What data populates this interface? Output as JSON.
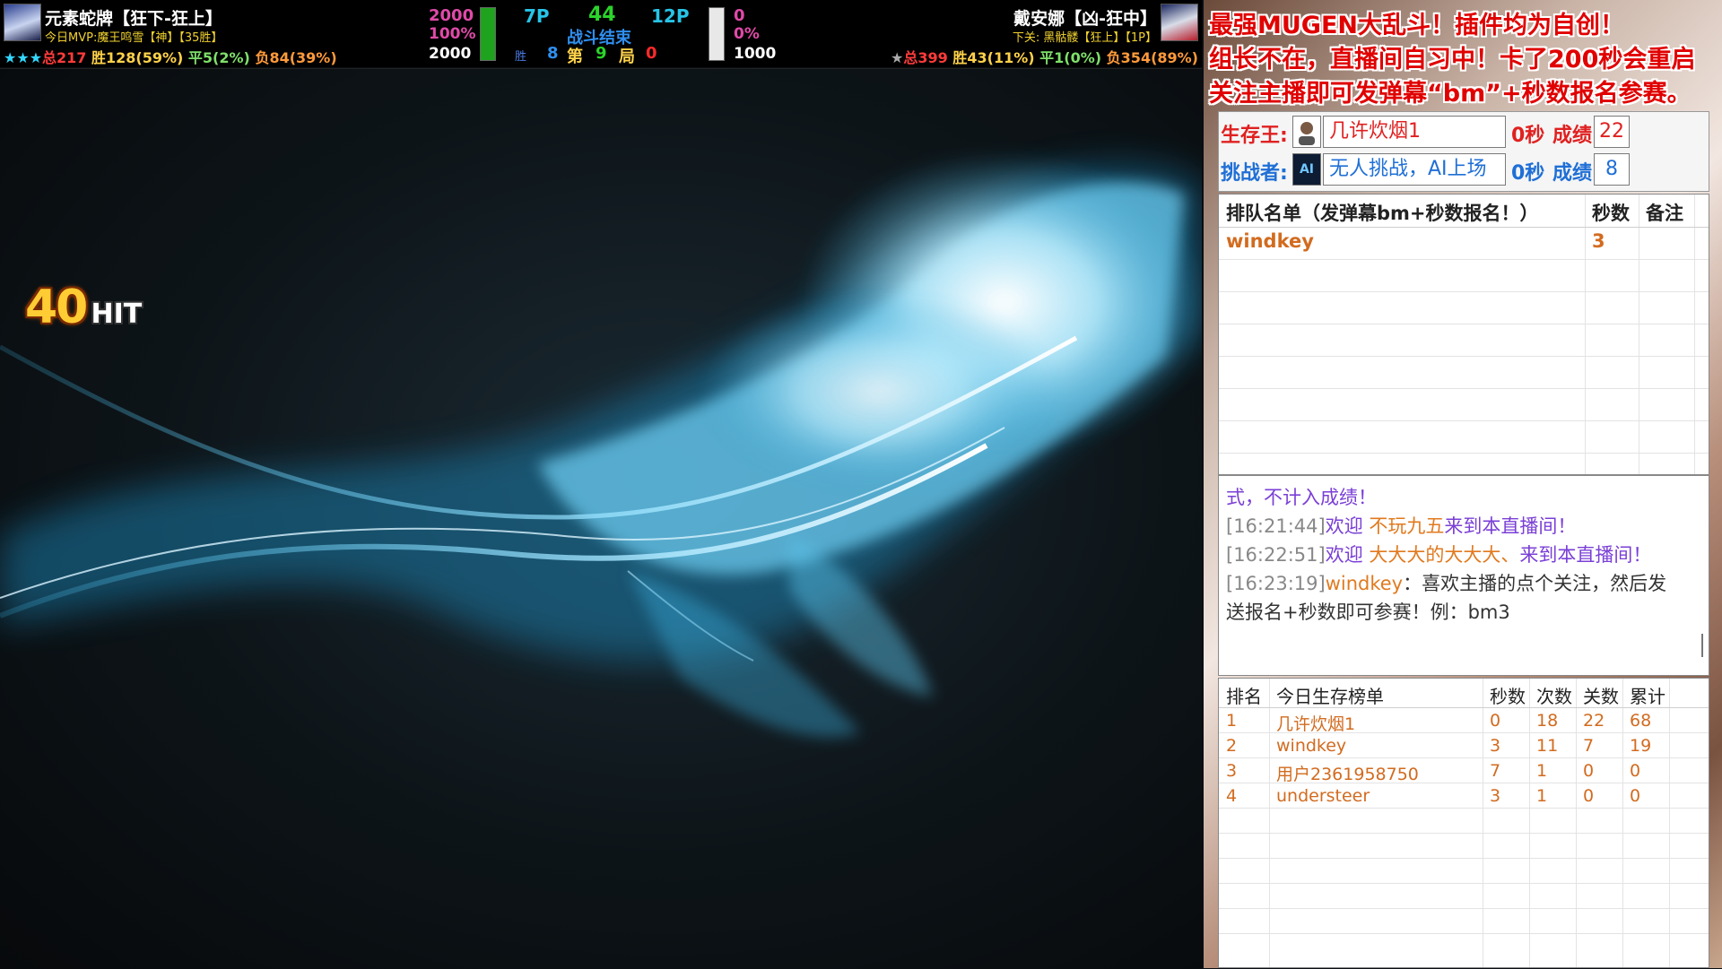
{
  "hud": {
    "p1": {
      "name": "元素蛇牌【狂下-狂上】",
      "mvp": "今日MVP:魔王鸣雪【神】【35胜】",
      "stars": "★★★",
      "record_total": "总217",
      "record_win": "胜128(59%)",
      "record_draw": "平5(2%)",
      "record_loss": "负84(39%)",
      "life_text": "2000",
      "power_pct": "100%",
      "life_max": "2000",
      "life_fill": 1.0
    },
    "p2": {
      "name": "戴安娜【凶-狂中】",
      "next": "下关: 黑骷髅【狂上】【1P】",
      "stars": "★",
      "record_total": "总399",
      "record_win": "胜43(11%)",
      "record_draw": "平1(0%)",
      "record_loss": "负354(89%)",
      "life_text": "0",
      "power_pct": "0%",
      "life_max": "1000",
      "life_fill": 1.0
    },
    "center": {
      "left_p": "7P",
      "timer": "44",
      "right_p": "12P",
      "status": "战斗结束",
      "win_label": "胜",
      "wins": "8",
      "round_prefix": "第",
      "round": "9",
      "round_suffix": "局",
      "round_extra": "0"
    }
  },
  "game": {
    "combo_number": "40",
    "combo_label": "HIT"
  },
  "panel": {
    "banner": [
      "最强MUGEN大乱斗！插件均为自创！",
      "组长不在，直播间自习中！卡了200秒会重启",
      "关注主播即可发弹幕“bm”+秒数报名参赛。"
    ],
    "king": {
      "label": "生存王:",
      "name": "几许炊烟1",
      "seconds": "0秒",
      "score_label": "成绩:",
      "score": "22"
    },
    "challenger": {
      "label": "挑战者:",
      "name": "无人挑战，AI上场",
      "seconds": "0秒",
      "score_label": "成绩:",
      "score": "8",
      "avatar": "AI"
    },
    "queue": {
      "headers": [
        "排队名单（发弹幕bm+秒数报名！）",
        "秒数",
        "备注"
      ],
      "rows": [
        {
          "name": "windkey",
          "seconds": "3",
          "note": ""
        }
      ]
    },
    "chat": [
      {
        "parts": [
          {
            "t": "式，不计入成绩！",
            "c": "#7a3fd6"
          }
        ]
      },
      {
        "parts": [
          {
            "t": "[16:21:44]",
            "c": "#888888"
          },
          {
            "t": "欢迎 ",
            "c": "#7a3fd6"
          },
          {
            "t": "不玩九五",
            "c": "#e07a1f"
          },
          {
            "t": "来到本直播间！",
            "c": "#7a3fd6"
          }
        ]
      },
      {
        "parts": [
          {
            "t": "[16:22:51]",
            "c": "#888888"
          },
          {
            "t": "欢迎 ",
            "c": "#7a3fd6"
          },
          {
            "t": "大大大的大大大、",
            "c": "#e07a1f"
          },
          {
            "t": "来到本直播间！",
            "c": "#7a3fd6"
          }
        ]
      },
      {
        "parts": [
          {
            "t": "[16:23:19]",
            "c": "#888888"
          },
          {
            "t": "windkey",
            "c": "#e07a1f"
          },
          {
            "t": "：喜欢主播的点个关注，然后发",
            "c": "#333333"
          }
        ]
      },
      {
        "parts": [
          {
            "t": "送报名+秒数即可参赛！例：bm3",
            "c": "#333333"
          }
        ]
      }
    ],
    "ranking": {
      "headers": [
        "排名",
        "今日生存榜单",
        "秒数",
        "次数",
        "关数",
        "累计"
      ],
      "rows": [
        [
          "1",
          "几许炊烟1",
          "0",
          "18",
          "22",
          "68"
        ],
        [
          "2",
          "windkey",
          "3",
          "11",
          "7",
          "19"
        ],
        [
          "3",
          "用户2361958750",
          "7",
          "1",
          "0",
          "0"
        ],
        [
          "4",
          "understeer",
          "3",
          "1",
          "0",
          "0"
        ]
      ]
    }
  },
  "colors": {
    "hud_bg": "#000000",
    "life_green": "#1fa31f",
    "banner_red": "#e00000",
    "field_blue": "#1f6fd6",
    "rank_orange": "#d26b1f"
  }
}
